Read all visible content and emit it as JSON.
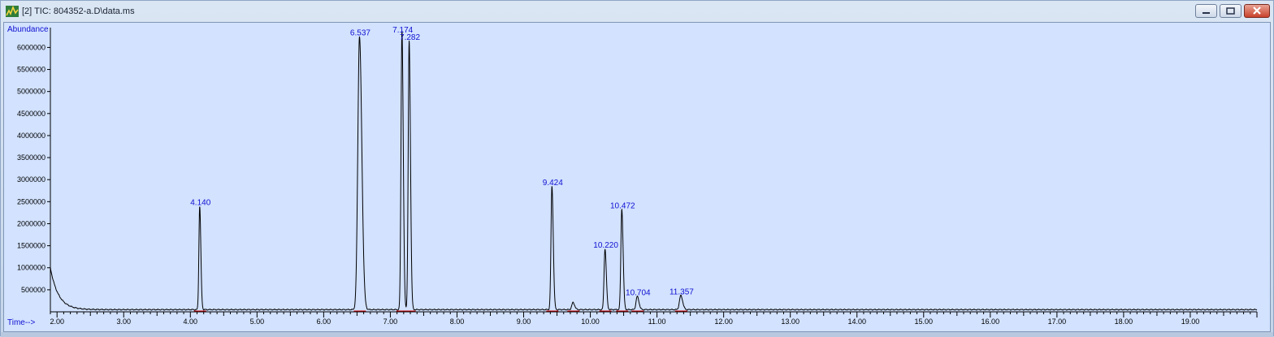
{
  "window": {
    "title": "[2] TIC: 804352-a.D\\data.ms",
    "icon": "chromatogram-app-icon"
  },
  "colors": {
    "background": "#d2e2ff",
    "trace": "#000000",
    "peak_label": "#1010d0",
    "baseline_marker": "#d00000",
    "axis_text": "#000000"
  },
  "chart_data": {
    "type": "line",
    "title": "",
    "ylabel": "Abundance",
    "xlabel": "Time-->",
    "xlim": [
      1.9,
      20.0
    ],
    "ylim": [
      0,
      6450000
    ],
    "x_ticks": [
      2.0,
      3.0,
      4.0,
      5.0,
      6.0,
      7.0,
      8.0,
      9.0,
      10.0,
      11.0,
      12.0,
      13.0,
      14.0,
      15.0,
      16.0,
      17.0,
      18.0,
      19.0
    ],
    "x_tick_labels": [
      "2.00",
      "3.00",
      "4.00",
      "5.00",
      "6.00",
      "7.00",
      "8.00",
      "9.00",
      "10.00",
      "11.00",
      "12.00",
      "13.00",
      "14.00",
      "15.00",
      "16.00",
      "17.00",
      "18.00",
      "19.00"
    ],
    "y_ticks": [
      500000,
      1000000,
      1500000,
      2000000,
      2500000,
      3000000,
      3500000,
      4000000,
      4500000,
      5000000,
      5500000,
      6000000
    ],
    "y_tick_labels": [
      "500000",
      "1000000",
      "1500000",
      "2000000",
      "2500000",
      "3000000",
      "3500000",
      "4000000",
      "4500000",
      "5000000",
      "5500000",
      "6000000"
    ],
    "baseline": 50000,
    "start_value": 1000000,
    "peaks": [
      {
        "rt": 4.14,
        "label": "4.140",
        "height": 2350000,
        "width": 0.012
      },
      {
        "rt": 6.537,
        "label": "6.537",
        "height": 6200000,
        "width": 0.025
      },
      {
        "rt": 7.174,
        "label": "7.174",
        "height": 6350000,
        "width": 0.014
      },
      {
        "rt": 7.282,
        "label": "7.282",
        "height": 6100000,
        "width": 0.014
      },
      {
        "rt": 9.424,
        "label": "9.424",
        "height": 2800000,
        "width": 0.014
      },
      {
        "rt": 9.74,
        "label": "",
        "height": 160000,
        "width": 0.018
      },
      {
        "rt": 10.22,
        "label": "10.220",
        "height": 1380000,
        "width": 0.014
      },
      {
        "rt": 10.472,
        "label": "10.472",
        "height": 2280000,
        "width": 0.014
      },
      {
        "rt": 10.704,
        "label": "10.704",
        "height": 300000,
        "width": 0.018
      },
      {
        "rt": 11.357,
        "label": "11.357",
        "height": 320000,
        "width": 0.02
      }
    ]
  }
}
